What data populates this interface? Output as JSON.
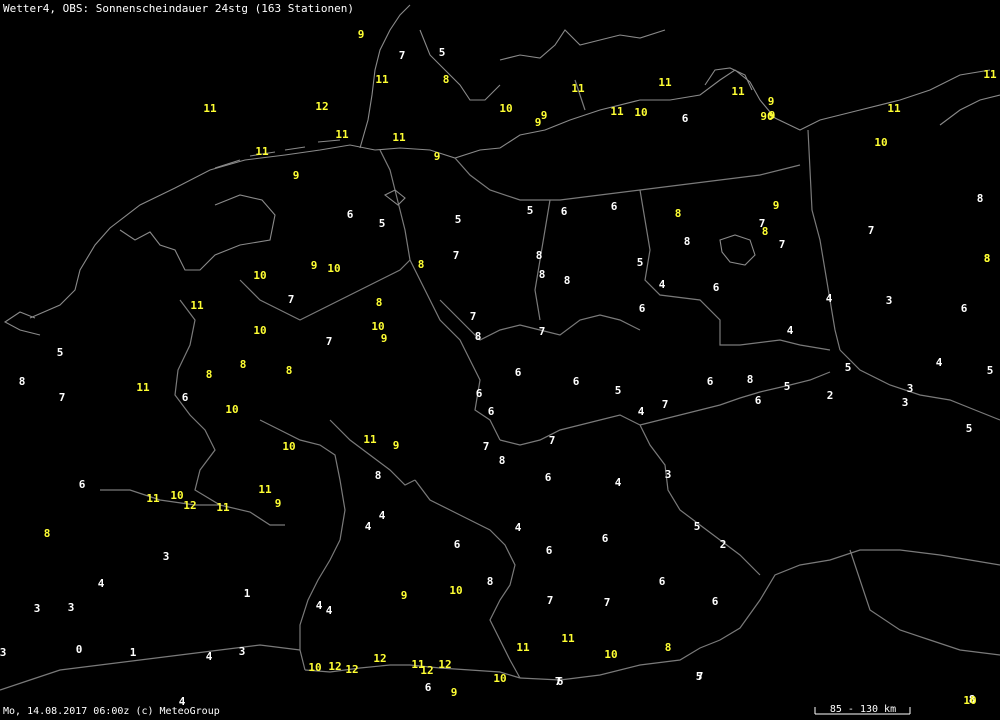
{
  "title": "Wetter4, OBS: Sonnenscheindauer 24stg (163 Stationen)",
  "footer": "Mo, 14.08.2017 06:00z (c) MeteoGroup",
  "scale": "85 - 130 km",
  "colors": {
    "background": "#000000",
    "high_value": "#ffff33",
    "low_value": "#ffffff",
    "borders": "#7a7a7a"
  },
  "map_labels": [
    {
      "v": "9",
      "c": "y"
    },
    {
      "v": "7",
      "c": "w"
    },
    {
      "v": "5",
      "c": "w"
    },
    {
      "v": "11",
      "c": "y"
    },
    {
      "v": "8",
      "c": "y"
    },
    {
      "v": "11",
      "c": "y"
    },
    {
      "v": "11",
      "c": "y"
    },
    {
      "v": "11",
      "c": "y"
    },
    {
      "v": "10",
      "c": "y"
    },
    {
      "v": "9",
      "c": "y"
    },
    {
      "v": "9",
      "c": "y"
    },
    {
      "v": "9",
      "c": "y"
    },
    {
      "v": "11",
      "c": "y"
    },
    {
      "v": "10",
      "c": "y"
    },
    {
      "v": "6",
      "c": "w"
    },
    {
      "v": "9",
      "c": "y"
    },
    {
      "v": "90",
      "c": "y"
    },
    {
      "v": "11",
      "c": "y"
    },
    {
      "v": "11",
      "c": "y"
    },
    {
      "v": "12",
      "c": "y"
    },
    {
      "v": "11",
      "c": "y"
    },
    {
      "v": "11",
      "c": "y"
    },
    {
      "v": "11",
      "c": "y"
    },
    {
      "v": "9",
      "c": "y"
    },
    {
      "v": "10",
      "c": "y"
    },
    {
      "v": "9",
      "c": "y"
    },
    {
      "v": "8",
      "c": "w"
    },
    {
      "v": "6",
      "c": "w"
    },
    {
      "v": "5",
      "c": "w"
    },
    {
      "v": "5",
      "c": "w"
    },
    {
      "v": "5",
      "c": "w"
    },
    {
      "v": "6",
      "c": "w"
    },
    {
      "v": "6",
      "c": "w"
    },
    {
      "v": "8",
      "c": "y"
    },
    {
      "v": "9",
      "c": "y"
    },
    {
      "v": "7",
      "c": "w"
    },
    {
      "v": "8",
      "c": "y"
    },
    {
      "v": "7",
      "c": "w"
    },
    {
      "v": "8",
      "c": "w"
    },
    {
      "v": "7",
      "c": "w"
    },
    {
      "v": "8",
      "c": "y"
    },
    {
      "v": "10",
      "c": "y"
    },
    {
      "v": "9",
      "c": "y"
    },
    {
      "v": "10",
      "c": "y"
    },
    {
      "v": "8",
      "c": "y"
    },
    {
      "v": "7",
      "c": "w"
    },
    {
      "v": "8",
      "c": "w"
    },
    {
      "v": "8",
      "c": "w"
    },
    {
      "v": "8",
      "c": "w"
    },
    {
      "v": "5",
      "c": "w"
    },
    {
      "v": "4",
      "c": "w"
    },
    {
      "v": "6",
      "c": "w"
    },
    {
      "v": "11",
      "c": "y"
    },
    {
      "v": "7",
      "c": "w"
    },
    {
      "v": "8",
      "c": "y"
    },
    {
      "v": "10",
      "c": "y"
    },
    {
      "v": "10",
      "c": "y"
    },
    {
      "v": "9",
      "c": "y"
    },
    {
      "v": "7",
      "c": "w"
    },
    {
      "v": "7",
      "c": "w"
    },
    {
      "v": "8",
      "c": "w"
    },
    {
      "v": "7",
      "c": "w"
    },
    {
      "v": "6",
      "c": "w"
    },
    {
      "v": "4",
      "c": "w"
    },
    {
      "v": "4",
      "c": "w"
    },
    {
      "v": "3",
      "c": "w"
    },
    {
      "v": "6",
      "c": "w"
    },
    {
      "v": "5",
      "c": "w"
    },
    {
      "v": "8",
      "c": "w"
    },
    {
      "v": "7",
      "c": "w"
    },
    {
      "v": "11",
      "c": "y"
    },
    {
      "v": "8",
      "c": "y"
    },
    {
      "v": "8",
      "c": "y"
    },
    {
      "v": "8",
      "c": "y"
    },
    {
      "v": "6",
      "c": "w"
    },
    {
      "v": "6",
      "c": "w"
    },
    {
      "v": "6",
      "c": "w"
    },
    {
      "v": "5",
      "c": "w"
    },
    {
      "v": "6",
      "c": "w"
    },
    {
      "v": "6",
      "c": "w"
    },
    {
      "v": "4",
      "c": "w"
    },
    {
      "v": "7",
      "c": "w"
    },
    {
      "v": "6",
      "c": "w"
    },
    {
      "v": "8",
      "c": "w"
    },
    {
      "v": "5",
      "c": "w"
    },
    {
      "v": "5",
      "c": "w"
    },
    {
      "v": "2",
      "c": "w"
    },
    {
      "v": "6",
      "c": "w"
    },
    {
      "v": "4",
      "c": "w"
    },
    {
      "v": "3",
      "c": "w"
    },
    {
      "v": "3",
      "c": "w"
    },
    {
      "v": "5",
      "c": "w"
    },
    {
      "v": "5",
      "c": "w"
    },
    {
      "v": "7",
      "c": "w"
    },
    {
      "v": "8",
      "c": "w"
    },
    {
      "v": "10",
      "c": "y"
    },
    {
      "v": "10",
      "c": "y"
    },
    {
      "v": "11",
      "c": "y"
    },
    {
      "v": "9",
      "c": "y"
    },
    {
      "v": "8",
      "c": "w"
    },
    {
      "v": "7",
      "c": "w"
    },
    {
      "v": "6",
      "c": "w"
    },
    {
      "v": "4",
      "c": "w"
    },
    {
      "v": "4",
      "c": "w"
    },
    {
      "v": "4",
      "c": "w"
    },
    {
      "v": "3",
      "c": "w"
    },
    {
      "v": "6",
      "c": "w"
    },
    {
      "v": "11",
      "c": "y"
    },
    {
      "v": "10",
      "c": "y"
    },
    {
      "v": "12",
      "c": "y"
    },
    {
      "v": "11",
      "c": "y"
    },
    {
      "v": "11",
      "c": "y"
    },
    {
      "v": "9",
      "c": "y"
    },
    {
      "v": "5",
      "c": "w"
    },
    {
      "v": "4",
      "c": "w"
    },
    {
      "v": "6",
      "c": "w"
    },
    {
      "v": "6",
      "c": "w"
    },
    {
      "v": "6",
      "c": "w"
    },
    {
      "v": "3",
      "c": "w"
    },
    {
      "v": "4",
      "c": "w"
    },
    {
      "v": "2",
      "c": "w"
    },
    {
      "v": "8",
      "c": "y"
    },
    {
      "v": "4",
      "c": "w"
    },
    {
      "v": "4",
      "c": "w"
    },
    {
      "v": "1",
      "c": "w"
    },
    {
      "v": "3",
      "c": "w"
    },
    {
      "v": "3",
      "c": "w"
    },
    {
      "v": "3",
      "c": "w"
    },
    {
      "v": "0",
      "c": "w"
    },
    {
      "v": "1",
      "c": "w"
    },
    {
      "v": "4",
      "c": "w"
    },
    {
      "v": "3",
      "c": "w"
    },
    {
      "v": "4",
      "c": "w"
    },
    {
      "v": "6",
      "c": "w"
    },
    {
      "v": "9",
      "c": "y"
    },
    {
      "v": "10",
      "c": "y"
    },
    {
      "v": "8",
      "c": "w"
    },
    {
      "v": "7",
      "c": "w"
    },
    {
      "v": "7",
      "c": "w"
    },
    {
      "v": "6",
      "c": "w"
    },
    {
      "v": "6",
      "c": "w"
    },
    {
      "v": "11",
      "c": "y"
    },
    {
      "v": "11",
      "c": "y"
    },
    {
      "v": "10",
      "c": "y"
    },
    {
      "v": "8",
      "c": "y"
    },
    {
      "v": "10",
      "c": "y"
    },
    {
      "v": "12",
      "c": "y"
    },
    {
      "v": "12",
      "c": "y"
    },
    {
      "v": "12",
      "c": "y"
    },
    {
      "v": "11",
      "c": "y"
    },
    {
      "v": "12",
      "c": "y"
    },
    {
      "v": "12",
      "c": "y"
    },
    {
      "v": "10",
      "c": "y"
    },
    {
      "v": "7",
      "c": "w"
    },
    {
      "v": "5",
      "c": "w"
    },
    {
      "v": "6",
      "c": "w"
    },
    {
      "v": "9",
      "c": "y"
    },
    {
      "v": "8",
      "c": "w"
    },
    {
      "v": "7",
      "c": "w"
    },
    {
      "v": "10",
      "c": "y"
    },
    {
      "v": "11",
      "c": "y"
    },
    {
      "v": "8",
      "c": "y"
    }
  ]
}
